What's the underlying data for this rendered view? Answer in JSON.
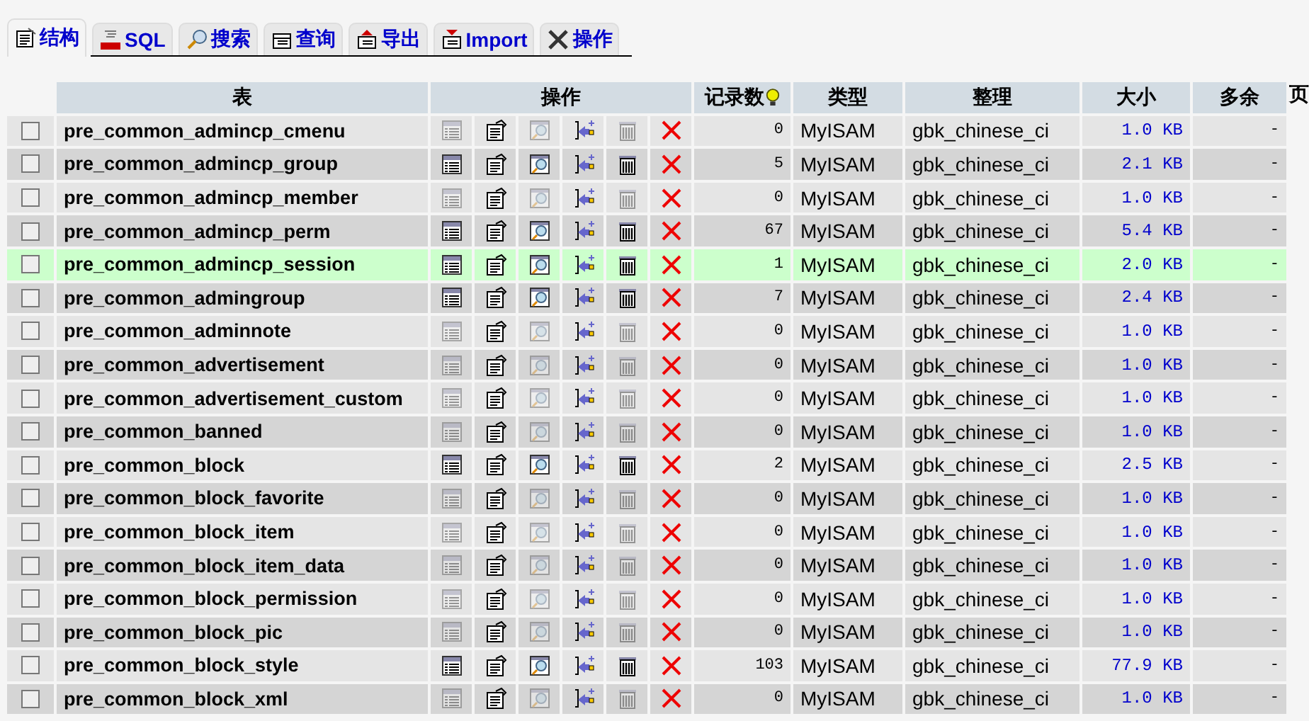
{
  "tabs": [
    {
      "label": "结构",
      "selected": true
    },
    {
      "label": "SQL",
      "selected": false
    },
    {
      "label": "搜索",
      "selected": false
    },
    {
      "label": "查询",
      "selected": false
    },
    {
      "label": "导出",
      "selected": false
    },
    {
      "label": "Import",
      "selected": false
    },
    {
      "label": "操作",
      "selected": false
    }
  ],
  "table": {
    "columns": [
      "表",
      "操作",
      "记录数",
      "类型",
      "整理",
      "大小",
      "多余",
      "页"
    ],
    "rows": [
      {
        "name": "pre_common_admincp_cmenu",
        "checked": false,
        "highlighted": false,
        "has_rows": false,
        "records": "0",
        "type": "MyISAM",
        "collation": "gbk_chinese_ci",
        "size": "1.0 KB",
        "overhead": "-"
      },
      {
        "name": "pre_common_admincp_group",
        "checked": false,
        "highlighted": false,
        "has_rows": true,
        "records": "5",
        "type": "MyISAM",
        "collation": "gbk_chinese_ci",
        "size": "2.1 KB",
        "overhead": "-"
      },
      {
        "name": "pre_common_admincp_member",
        "checked": false,
        "highlighted": false,
        "has_rows": false,
        "records": "0",
        "type": "MyISAM",
        "collation": "gbk_chinese_ci",
        "size": "1.0 KB",
        "overhead": "-"
      },
      {
        "name": "pre_common_admincp_perm",
        "checked": false,
        "highlighted": false,
        "has_rows": true,
        "records": "67",
        "type": "MyISAM",
        "collation": "gbk_chinese_ci",
        "size": "5.4 KB",
        "overhead": "-"
      },
      {
        "name": "pre_common_admincp_session",
        "checked": false,
        "highlighted": true,
        "has_rows": true,
        "records": "1",
        "type": "MyISAM",
        "collation": "gbk_chinese_ci",
        "size": "2.0 KB",
        "overhead": "-"
      },
      {
        "name": "pre_common_admingroup",
        "checked": false,
        "highlighted": false,
        "has_rows": true,
        "records": "7",
        "type": "MyISAM",
        "collation": "gbk_chinese_ci",
        "size": "2.4 KB",
        "overhead": "-"
      },
      {
        "name": "pre_common_adminnote",
        "checked": false,
        "highlighted": false,
        "has_rows": false,
        "records": "0",
        "type": "MyISAM",
        "collation": "gbk_chinese_ci",
        "size": "1.0 KB",
        "overhead": "-"
      },
      {
        "name": "pre_common_advertisement",
        "checked": false,
        "highlighted": false,
        "has_rows": false,
        "records": "0",
        "type": "MyISAM",
        "collation": "gbk_chinese_ci",
        "size": "1.0 KB",
        "overhead": "-"
      },
      {
        "name": "pre_common_advertisement_custom",
        "checked": false,
        "highlighted": false,
        "has_rows": false,
        "records": "0",
        "type": "MyISAM",
        "collation": "gbk_chinese_ci",
        "size": "1.0 KB",
        "overhead": "-"
      },
      {
        "name": "pre_common_banned",
        "checked": false,
        "highlighted": false,
        "has_rows": false,
        "records": "0",
        "type": "MyISAM",
        "collation": "gbk_chinese_ci",
        "size": "1.0 KB",
        "overhead": "-"
      },
      {
        "name": "pre_common_block",
        "checked": false,
        "highlighted": false,
        "has_rows": true,
        "records": "2",
        "type": "MyISAM",
        "collation": "gbk_chinese_ci",
        "size": "2.5 KB",
        "overhead": "-"
      },
      {
        "name": "pre_common_block_favorite",
        "checked": false,
        "highlighted": false,
        "has_rows": false,
        "records": "0",
        "type": "MyISAM",
        "collation": "gbk_chinese_ci",
        "size": "1.0 KB",
        "overhead": "-"
      },
      {
        "name": "pre_common_block_item",
        "checked": false,
        "highlighted": false,
        "has_rows": false,
        "records": "0",
        "type": "MyISAM",
        "collation": "gbk_chinese_ci",
        "size": "1.0 KB",
        "overhead": "-"
      },
      {
        "name": "pre_common_block_item_data",
        "checked": false,
        "highlighted": false,
        "has_rows": false,
        "records": "0",
        "type": "MyISAM",
        "collation": "gbk_chinese_ci",
        "size": "1.0 KB",
        "overhead": "-"
      },
      {
        "name": "pre_common_block_permission",
        "checked": false,
        "highlighted": false,
        "has_rows": false,
        "records": "0",
        "type": "MyISAM",
        "collation": "gbk_chinese_ci",
        "size": "1.0 KB",
        "overhead": "-"
      },
      {
        "name": "pre_common_block_pic",
        "checked": false,
        "highlighted": false,
        "has_rows": false,
        "records": "0",
        "type": "MyISAM",
        "collation": "gbk_chinese_ci",
        "size": "1.0 KB",
        "overhead": "-"
      },
      {
        "name": "pre_common_block_style",
        "checked": false,
        "highlighted": false,
        "has_rows": true,
        "records": "103",
        "type": "MyISAM",
        "collation": "gbk_chinese_ci",
        "size": "77.9 KB",
        "overhead": "-"
      },
      {
        "name": "pre_common_block_xml",
        "checked": false,
        "highlighted": false,
        "has_rows": false,
        "records": "0",
        "type": "MyISAM",
        "collation": "gbk_chinese_ci",
        "size": "1.0 KB",
        "overhead": "-"
      }
    ]
  }
}
